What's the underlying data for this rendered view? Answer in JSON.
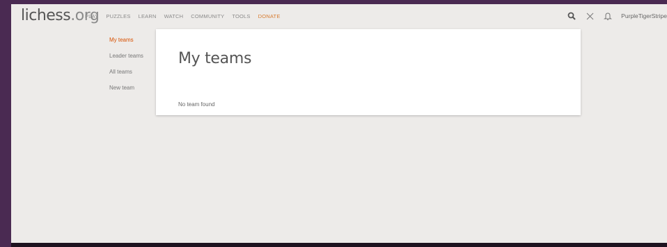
{
  "header": {
    "logo_main": "lichess",
    "logo_tld": ".org",
    "nav": [
      "PLAY",
      "PUZZLES",
      "LEARN",
      "WATCH",
      "COMMUNITY",
      "TOOLS",
      "DONATE"
    ],
    "username": "PurpleTigerStripe"
  },
  "icons": {
    "search": "search-icon",
    "swords": "challenge-icon",
    "bell": "notification-bell-icon"
  },
  "sidebar": {
    "items": [
      {
        "label": "My teams",
        "active": true
      },
      {
        "label": "Leader teams"
      },
      {
        "label": "All teams"
      },
      {
        "label": "New team"
      }
    ]
  },
  "main": {
    "title": "My teams",
    "empty_message": "No team found"
  },
  "colors": {
    "accent": "#d85000",
    "donate": "#d77d32",
    "frame": "#4a2a52",
    "background": "#edebe9"
  }
}
